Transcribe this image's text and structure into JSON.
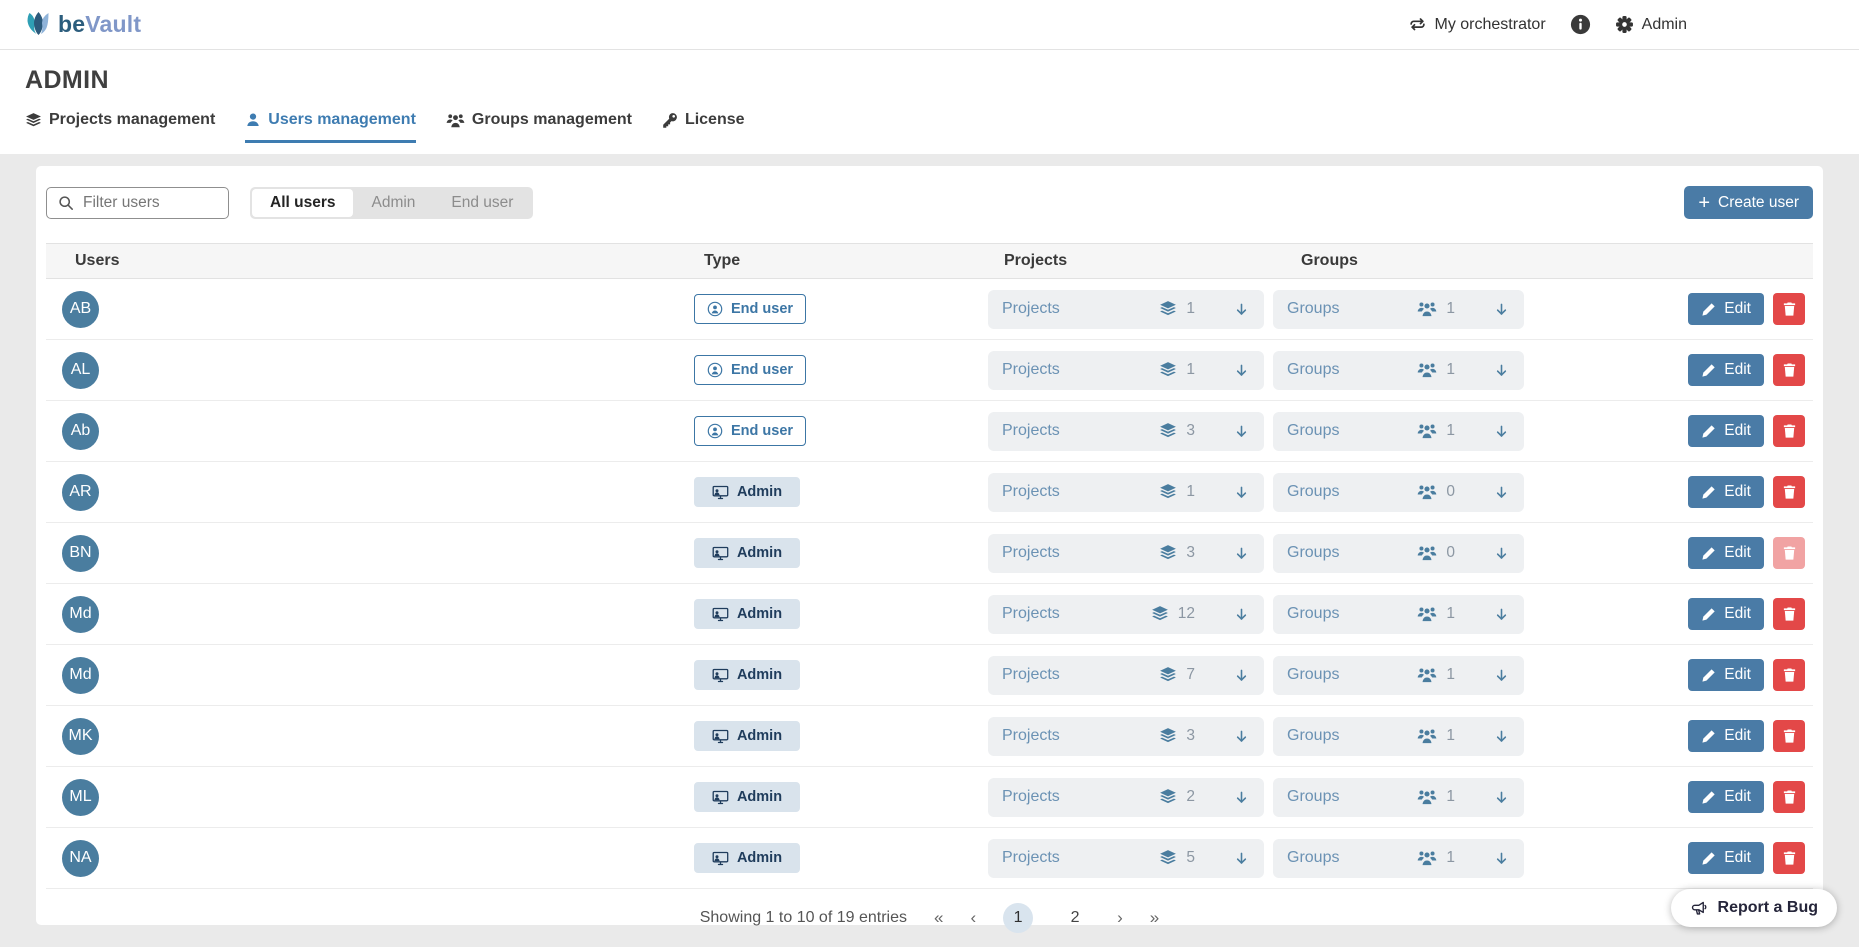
{
  "brand": {
    "name_bold": "be",
    "name_light": "Vault"
  },
  "topbar": {
    "orchestrator": "My orchestrator",
    "admin": "Admin"
  },
  "page": {
    "title": "ADMIN"
  },
  "tabs": [
    {
      "label": "Projects management",
      "icon": "layers-icon",
      "active": false
    },
    {
      "label": "Users management",
      "icon": "person-icon",
      "active": true
    },
    {
      "label": "Groups management",
      "icon": "people-icon",
      "active": false
    },
    {
      "label": "License",
      "icon": "key-icon",
      "active": false
    }
  ],
  "toolbar": {
    "filter_placeholder": "Filter users",
    "segments": [
      "All users",
      "Admin",
      "End user"
    ],
    "active_segment": "All users",
    "create_icon": "+",
    "create_label": "Create user"
  },
  "table": {
    "headers": [
      "Users",
      "Type",
      "Projects",
      "Groups"
    ],
    "projects_cell_label": "Projects",
    "groups_cell_label": "Groups",
    "edit_label": "Edit",
    "rows": [
      {
        "initials": "AB",
        "type": "End user",
        "projects": 1,
        "groups": 1,
        "delete_disabled": false
      },
      {
        "initials": "AL",
        "type": "End user",
        "projects": 1,
        "groups": 1,
        "delete_disabled": false
      },
      {
        "initials": "Ab",
        "type": "End user",
        "projects": 3,
        "groups": 1,
        "delete_disabled": false
      },
      {
        "initials": "AR",
        "type": "Admin",
        "projects": 1,
        "groups": 0,
        "delete_disabled": false
      },
      {
        "initials": "BN",
        "type": "Admin",
        "projects": 3,
        "groups": 0,
        "delete_disabled": true
      },
      {
        "initials": "Md",
        "type": "Admin",
        "projects": 12,
        "groups": 1,
        "delete_disabled": false
      },
      {
        "initials": "Md",
        "type": "Admin",
        "projects": 7,
        "groups": 1,
        "delete_disabled": false
      },
      {
        "initials": "MK",
        "type": "Admin",
        "projects": 3,
        "groups": 1,
        "delete_disabled": false
      },
      {
        "initials": "ML",
        "type": "Admin",
        "projects": 2,
        "groups": 1,
        "delete_disabled": false
      },
      {
        "initials": "NA",
        "type": "Admin",
        "projects": 5,
        "groups": 1,
        "delete_disabled": false
      }
    ]
  },
  "pagination": {
    "summary": "Showing 1 to 10 of 19 entries",
    "first_icon": "«",
    "prev_icon": "‹",
    "next_icon": "›",
    "last_icon": "»",
    "pages": [
      "1",
      "2"
    ],
    "current_page": "1"
  },
  "report_bug": {
    "label": "Report a Bug"
  },
  "colors": {
    "accent_blue": "#4a7ba6",
    "avatar_blue": "#4a7d9f",
    "active_tab_blue": "#3e7cb1",
    "danger_red": "#e34848",
    "danger_red_disabled": "#f1a3a3",
    "admin_chip_bg": "#d9e3ec",
    "admin_chip_text": "#1f3c5c",
    "cell_bg": "#eef0f2",
    "page_bg": "#eaeaea",
    "brand_dark": "#2c5d7d",
    "brand_light": "#8097c8"
  }
}
